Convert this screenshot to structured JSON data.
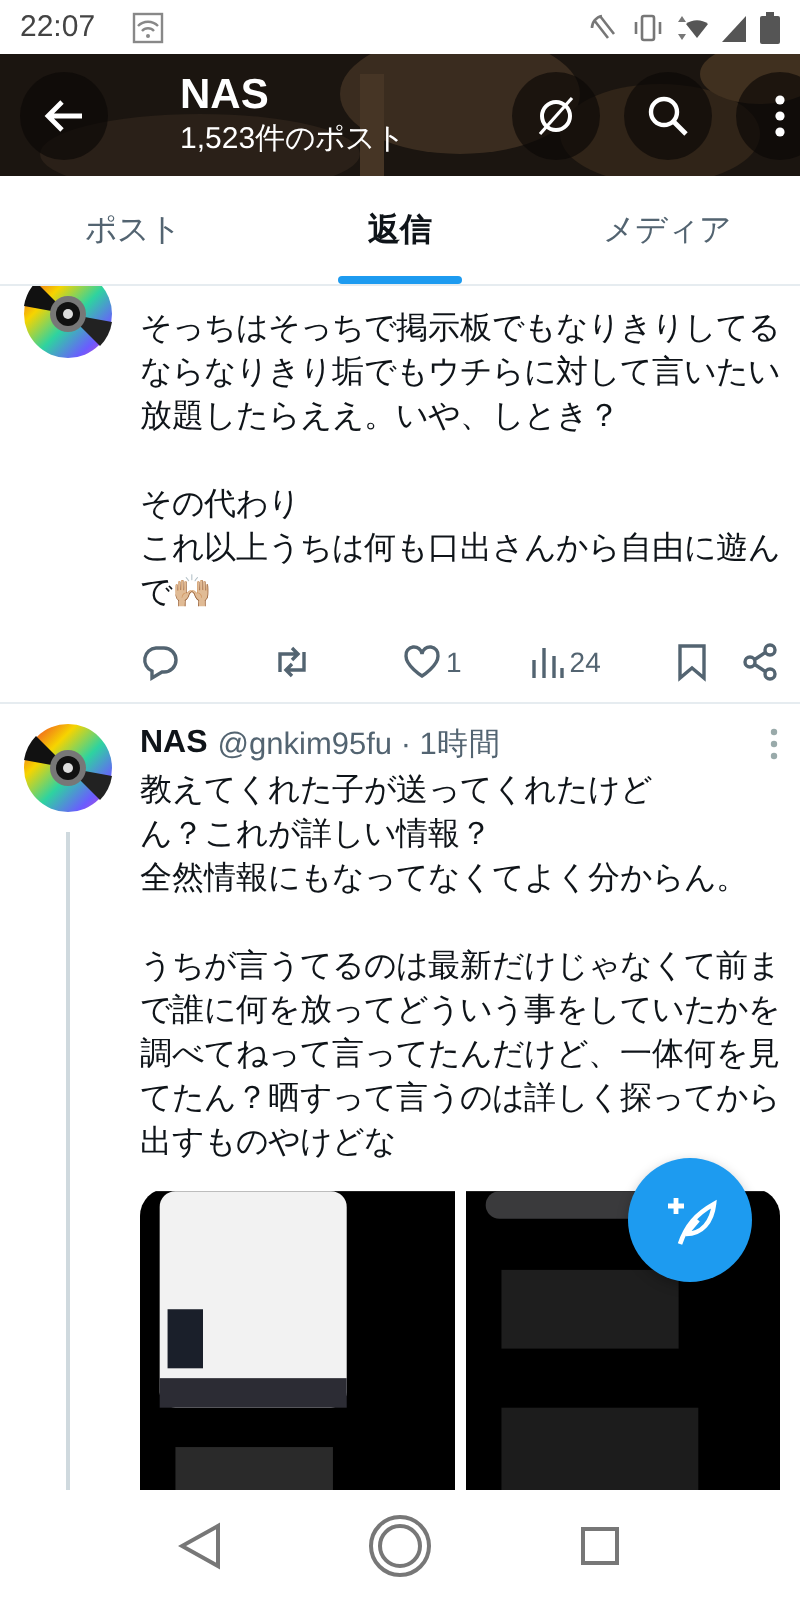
{
  "status_bar": {
    "time": "22:07"
  },
  "header": {
    "title": "NAS",
    "subtitle": "1,523件のポスト"
  },
  "tabs": [
    {
      "label": "ポスト",
      "selected": false
    },
    {
      "label": "返信",
      "selected": true
    },
    {
      "label": "メディア",
      "selected": false
    }
  ],
  "posts": [
    {
      "threaded": false,
      "paragraphs": [
        [
          "そっちはそっちで掲示板でもなりきりしてるならなりきり垢でもウチらに対して言いたい放題したらええ。いや、しとき？"
        ],
        [
          "その代わり",
          "これ以上うちは何も口出さんから自由に遊んで🙌🏼"
        ]
      ],
      "actions": {
        "likes": "1",
        "views": "24"
      }
    },
    {
      "threaded": true,
      "author": "NAS",
      "handle": "@gnkim95fu · 1時間",
      "paragraphs": [
        [
          "教えてくれた子が送ってくれたけど",
          "ん？これが詳しい情報？",
          "全然情報にもなってなくてよく分からん。"
        ],
        [
          "うちが言うてるのは最新だけじゃなくて前まで誰に何を放ってどういう事をしていたかを調べてねって言ってたんだけど、一体何を見てたん？晒すって言うのは詳しく探ってから出すものやけどな"
        ]
      ],
      "media": [
        {
          "kind": "picture"
        },
        {
          "kind": "picture"
        }
      ]
    }
  ]
}
